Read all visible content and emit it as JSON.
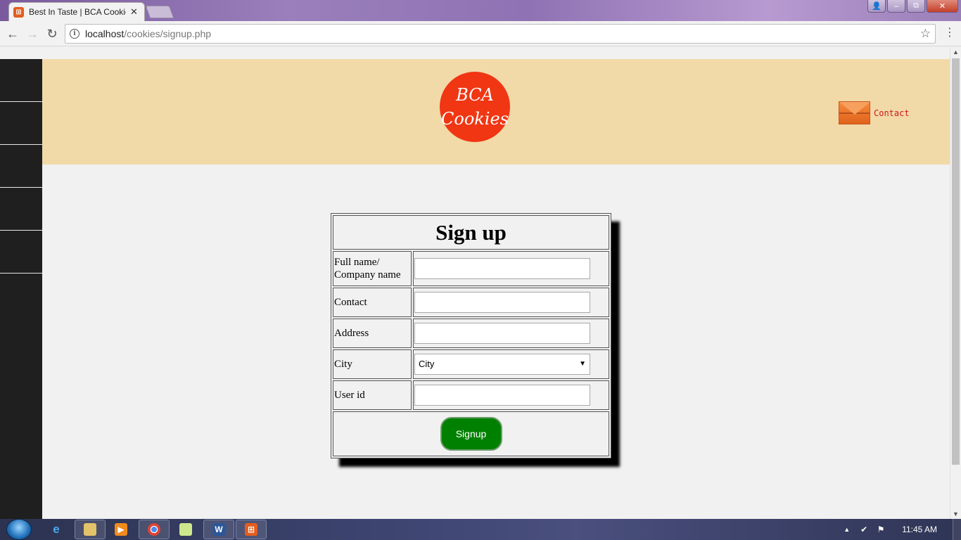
{
  "browser": {
    "tab_title": "Best In Taste | BCA Cookies",
    "tab_favicon": "xampp-favicon-icon",
    "url_host": "localhost",
    "url_path": "/cookies/signup.php"
  },
  "header": {
    "logo_line1": "BCA",
    "logo_line2": "Cookies",
    "contact_label": "Contact",
    "logo_color": "#f03613",
    "header_bg": "#f2d9a8"
  },
  "sidebar": {
    "items": [
      "",
      "",
      "",
      "",
      ""
    ]
  },
  "form": {
    "title": "Sign up",
    "fields": {
      "fullname_label": "Full name/ Company name",
      "contact_label": "Contact",
      "address_label": "Address",
      "city_label": "City",
      "city_selected": "City",
      "userid_label": "User id"
    },
    "submit_label": "Signup",
    "submit_color": "#008000"
  },
  "taskbar": {
    "clock": "11:45 AM",
    "items": [
      "internet-explorer-icon",
      "file-explorer-icon",
      "media-player-icon",
      "chrome-icon",
      "notepad-icon",
      "word-icon",
      "xampp-icon"
    ]
  }
}
